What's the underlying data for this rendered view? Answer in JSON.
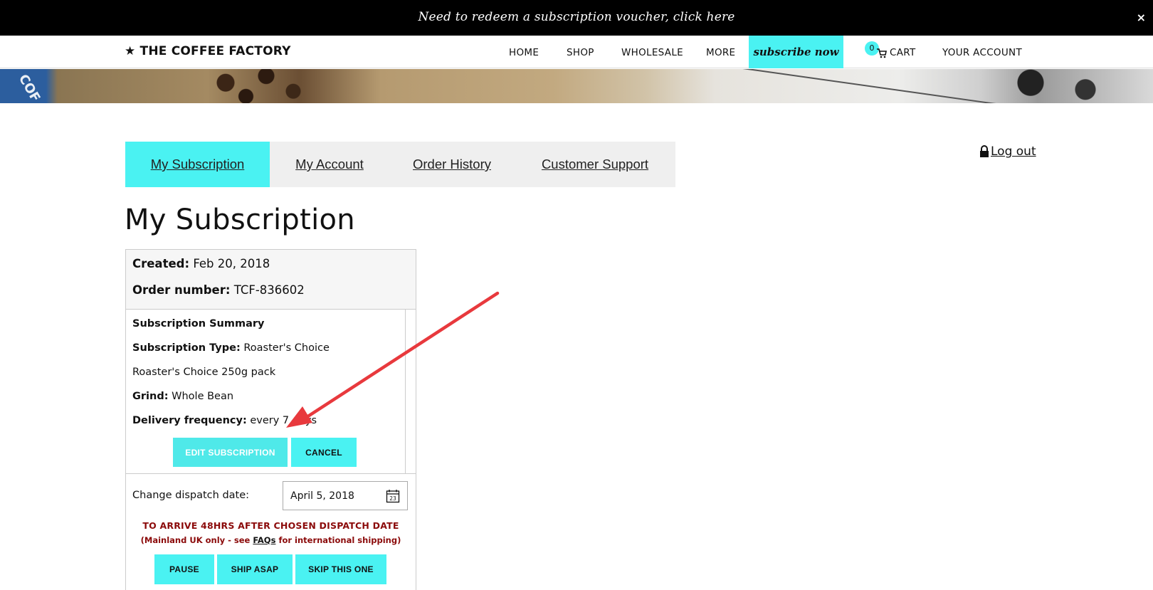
{
  "announcement": {
    "text": "Need to redeem a subscription voucher, click here",
    "close": "×"
  },
  "header": {
    "logo": "★ THE COFFEE FACTORY",
    "nav": [
      "HOME",
      "SHOP",
      "WHOLESALE",
      "MORE"
    ],
    "subscribe": "subscribe now",
    "cart_count": "0",
    "cart_label": "CART",
    "account_label": "YOUR ACCOUNT"
  },
  "tabs": [
    "My Subscription",
    "My Account",
    "Order History",
    "Customer Support"
  ],
  "logout": "Log out",
  "page_title": "My Subscription",
  "subscription": {
    "created_label": "Created:",
    "created_value": "Feb 20, 2018",
    "order_label": "Order number:",
    "order_value": "TCF-836602",
    "summary_title": "Subscription Summary",
    "type_label": "Subscription Type:",
    "type_value": "Roaster's Choice",
    "pack": "Roaster's Choice 250g pack",
    "grind_label": "Grind:",
    "grind_value": "Whole Bean",
    "freq_label": "Delivery frequency:",
    "freq_value": "every 7 days",
    "edit_button": "EDIT SUBSCRIPTION",
    "cancel_button": "CANCEL"
  },
  "dispatch": {
    "label": "Change dispatch date:",
    "date_value": "April 5, 2018",
    "calendar_day": "23",
    "arrive_note": "TO ARRIVE 48HRS AFTER CHOSEN DISPATCH DATE",
    "uk_note_pre": "(Mainland UK only - see ",
    "uk_note_link": "FAQs",
    "uk_note_post": " for international shipping)",
    "pause_button": "PAUSE",
    "ship_button": "SHIP ASAP",
    "skip_button": "SKIP THIS ONE"
  },
  "colors": {
    "accent": "#4af2f2",
    "warning_text": "#8b0a0a",
    "annotation_arrow": "#e8393d"
  }
}
